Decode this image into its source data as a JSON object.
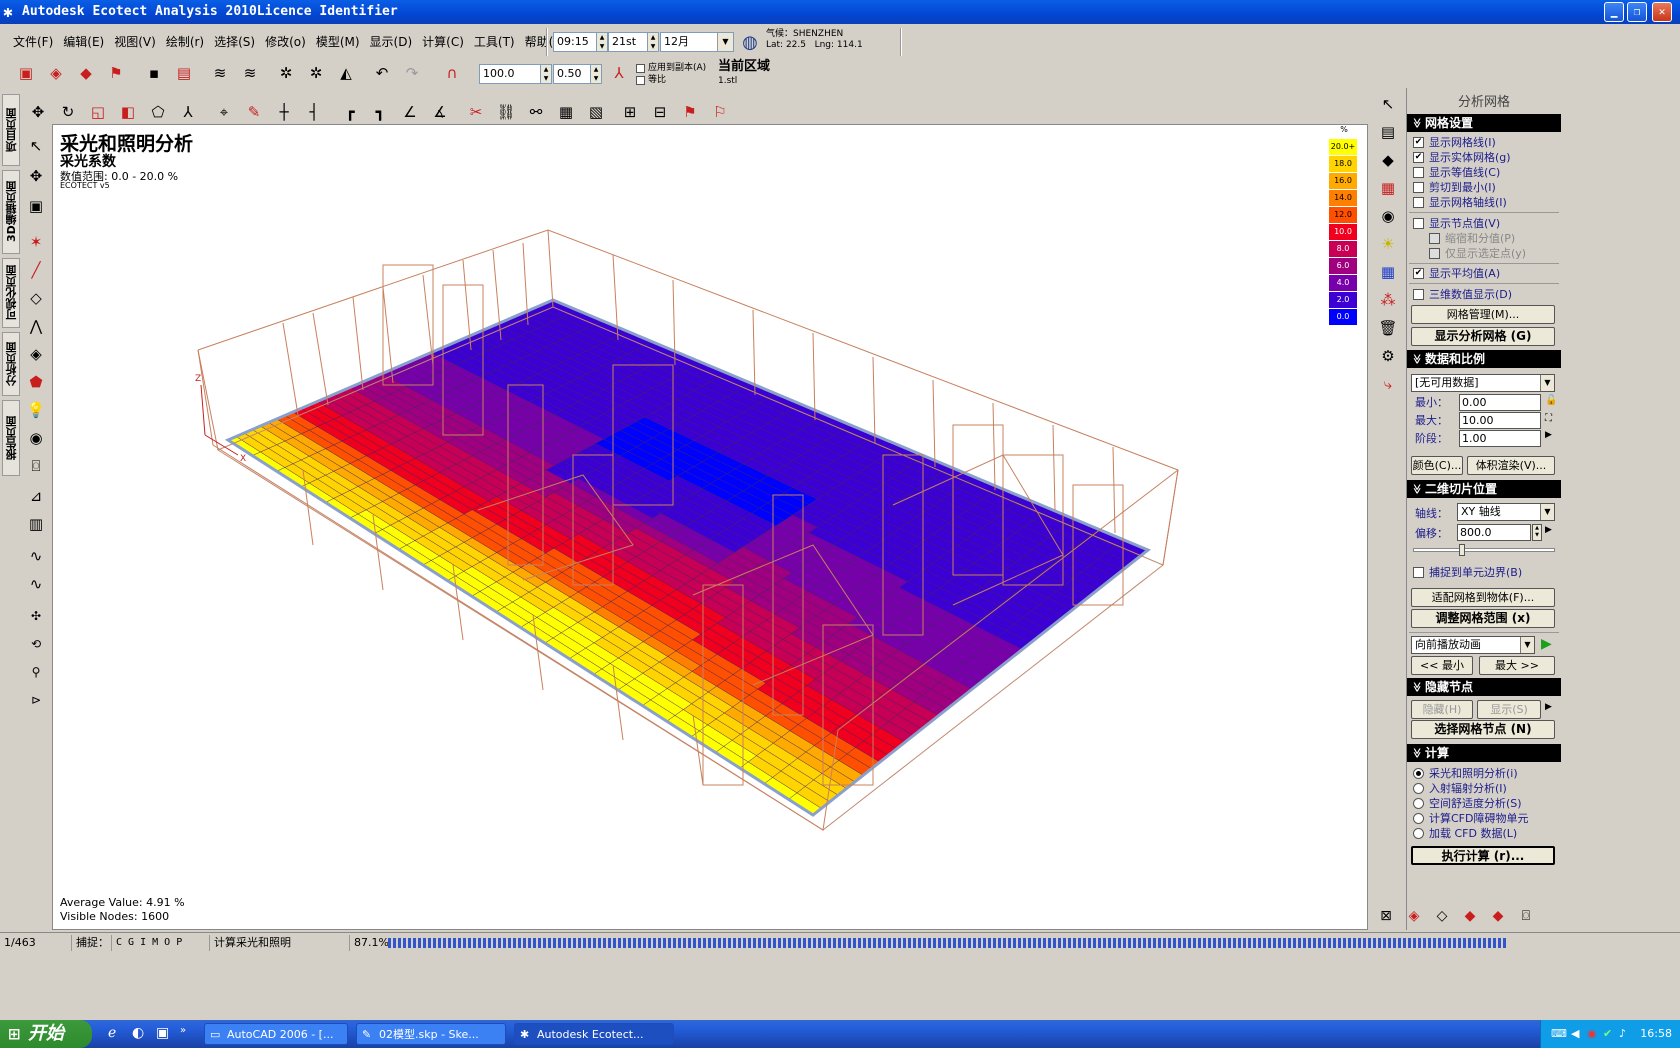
{
  "window": {
    "title": "Autodesk Ecotect Analysis 2010Licence Identifier"
  },
  "menu": [
    "文件(F)",
    "编辑(E)",
    "视图(V)",
    "绘制(r)",
    "选择(S)",
    "修改(o)",
    "模型(M)",
    "显示(D)",
    "计算(C)",
    "工具(T)",
    "帮助(H)"
  ],
  "timebar": {
    "time": "09:15",
    "day": "21st",
    "month": "12月",
    "location_label": "气候：SHENZHEN",
    "lat": "Lat: 22.5",
    "lng": "Lng: 114.1"
  },
  "toolbar2": {
    "zoom_value": "100.0",
    "step_value": "0.50",
    "apply_label": "应用到副本(A)",
    "equal_label": "等比",
    "zone_label": "当前区域",
    "zone_sub": "1.stl"
  },
  "left_tabs": [
    "项目页面",
    "3D编辑页面",
    "可视化页面",
    "分析页面",
    "报告页面"
  ],
  "viewport": {
    "title": "采光和照明分析",
    "subtitle": "采光系数",
    "range": "数值范围: 0.0 - 20.0 %",
    "brand": "ECOTECT v5",
    "avg": "Average Value: 4.91 %",
    "nodes": "Visible Nodes: 1600",
    "axis_x": "X",
    "axis_z": "Z"
  },
  "legend": {
    "unit": "%",
    "items": [
      {
        "label": "20.0+",
        "color": "#ffff00"
      },
      {
        "label": "18.0",
        "color": "#ffd400"
      },
      {
        "label": "16.0",
        "color": "#ffaa00"
      },
      {
        "label": "14.0",
        "color": "#ff7f00"
      },
      {
        "label": "12.0",
        "color": "#ff4f00"
      },
      {
        "label": "10.0",
        "color": "#f0001e"
      },
      {
        "label": "8.0",
        "color": "#c80055"
      },
      {
        "label": "6.0",
        "color": "#a0007f"
      },
      {
        "label": "4.0",
        "color": "#7800aa"
      },
      {
        "label": "2.0",
        "color": "#3c00d4"
      },
      {
        "label": "0.0",
        "color": "#0000ff"
      }
    ]
  },
  "panel": {
    "title": "分析网格",
    "grid_settings": {
      "header": "网格设置",
      "show_grid_lines": "显示网格线(I)",
      "show_solid_grid": "显示实体网格(g)",
      "show_contours": "显示等值线(C)",
      "clip_min": "剪切到最小(I)",
      "show_axes": "显示网格轴线(I)",
      "show_node_values": "显示节点值(V)",
      "shrink": "缩宿和分值(P)",
      "only_selected": "仅显示选定点(y)",
      "show_average": "显示平均值(A)",
      "show_3d_values": "三维数值显示(D)",
      "manage_btn": "网格管理(M)...",
      "show_grid_btn": "显示分析网格 (G)"
    },
    "data_scale": {
      "header": "数据和比例",
      "dataset": "[无可用数据]",
      "min_label": "最小：",
      "min_value": "0.00",
      "max_label": "最大：",
      "max_value": "10.00",
      "step_label": "阶段：",
      "step_value": "1.00",
      "color_btn": "颜色(C)...",
      "volume_btn": "体积渲染(V)..."
    },
    "slice": {
      "header": "二维切片位置",
      "axis_label": "轴线：",
      "axis_value": "XY 轴线",
      "offset_label": "偏移：",
      "offset_value": "800.0",
      "snap_label": "捕捉到单元边界(B)",
      "fit_btn": "适配网格到物体(F)...",
      "adjust_btn": "调整网格范围 (x)"
    },
    "animation": {
      "mode": "向前播放动画",
      "min_btn": "<< 最小",
      "max_btn": "最大 >>"
    },
    "hidden_nodes": {
      "header": "隐藏节点",
      "hide_btn": "隐藏(H)",
      "show_btn": "显示(S)",
      "select_btn": "选择网格节点 (N)"
    },
    "calc": {
      "header": "计算",
      "options": [
        "采光和照明分析(i)",
        "入射辐射分析(I)",
        "空间舒适度分析(S)",
        "计算CFD障碍物单元",
        "加载 CFD 数据(L)"
      ],
      "run_btn": "执行计算 (r)..."
    }
  },
  "statusbar": {
    "count": "1/463",
    "snap": "捕捉：",
    "snap_flags": "C G I  M O P",
    "task": "计算采光和照明",
    "percent": "87.1%"
  },
  "taskbar": {
    "start": "开始",
    "tasks": [
      "AutoCAD 2006 - [...",
      "02模型.skp - Ske...",
      "Autodesk Ecotect..."
    ],
    "clock": "16:58"
  },
  "heatmap_colors": [
    "#0000ff",
    "#3c00d4",
    "#7800aa",
    "#a0007f",
    "#c80055",
    "#f0001e",
    "#ff4f00",
    "#ff7f00",
    "#ffaa00",
    "#ffd400",
    "#ffff00"
  ]
}
